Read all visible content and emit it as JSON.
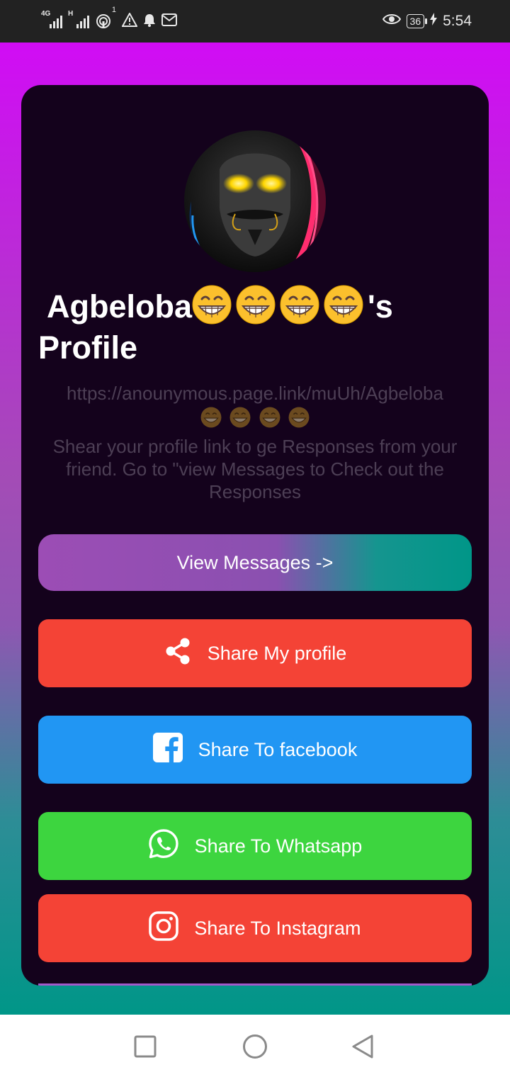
{
  "status_bar": {
    "network_1": "4G",
    "network_2": "H",
    "hotspot_count": "1",
    "battery": "36",
    "time": "5:54",
    "icons": [
      "signal-icon",
      "hotspot-icon",
      "warning-icon",
      "bell-icon",
      "mail-icon",
      "eye-icon",
      "battery-icon",
      "charging-icon"
    ]
  },
  "profile": {
    "name": "Agbeloba",
    "emoji_count": 4,
    "title_suffix": "'s",
    "title_line2": "Profile",
    "link": "https://anounymous.page.link/muUh/Agbeloba",
    "description": "Shear your profile link to ge Responses from your friend. Go to \"view Messages to Check out the Responses"
  },
  "buttons": {
    "view_messages": "View Messages ->",
    "share_profile": "Share My profile",
    "share_facebook": "Share To facebook",
    "share_whatsapp": "Share To Whatsapp",
    "share_instagram": "Share To Instagram"
  },
  "colors": {
    "share_red": "#f44336",
    "facebook_blue": "#2196f3",
    "whatsapp_green": "#3dd53f",
    "teal": "#009688",
    "purple": "#9c4db5",
    "card": "#14021c"
  }
}
